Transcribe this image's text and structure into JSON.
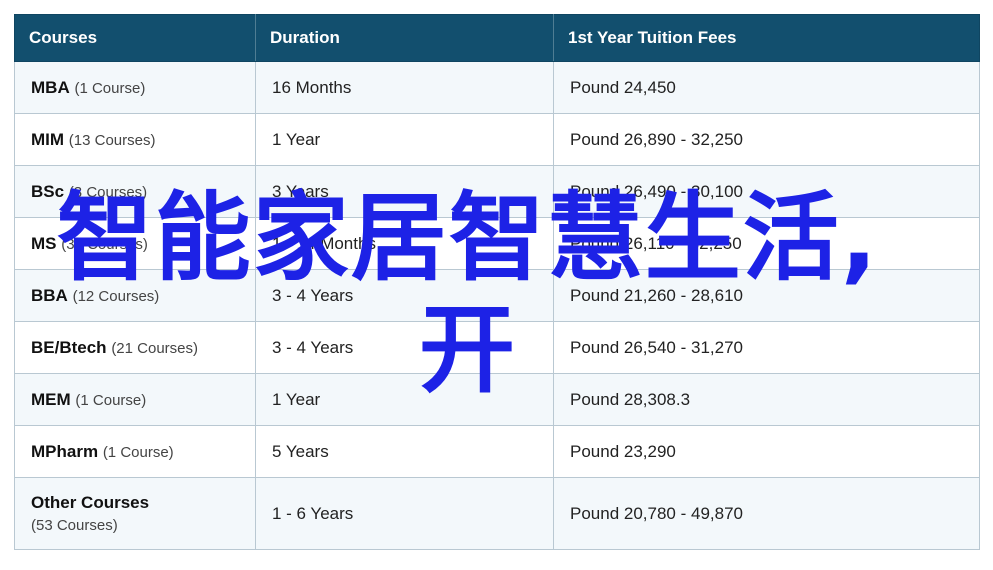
{
  "table": {
    "headers": [
      "Courses",
      "Duration",
      "1st Year Tuition Fees"
    ],
    "rows": [
      {
        "name": "MBA",
        "count": "(1 Course)",
        "duration": "16 Months",
        "fee": "Pound 24,450"
      },
      {
        "name": "MIM",
        "count": "(13 Courses)",
        "duration": "1 Year",
        "fee": "Pound 26,890 - 32,250"
      },
      {
        "name": "BSc",
        "count": "(3 Courses)",
        "duration": "3 Years",
        "fee": "Pound 26,490 - 30,100"
      },
      {
        "name": "MS",
        "count": "(39 Courses)",
        "duration": "1 - 14 Months",
        "fee": "Pound 26,110 - 32,250"
      },
      {
        "name": "BBA",
        "count": "(12 Courses)",
        "duration": "3 - 4 Years",
        "fee": "Pound 21,260 - 28,610"
      },
      {
        "name": "BE/Btech",
        "count": "(21 Courses)",
        "duration": "3 - 4 Years",
        "fee": "Pound 26,540 - 31,270"
      },
      {
        "name": "MEM",
        "count": "(1 Course)",
        "duration": "1 Year",
        "fee": "Pound 28,308.3"
      },
      {
        "name": "MPharm",
        "count": "(1 Course)",
        "duration": "5 Years",
        "fee": "Pound 23,290"
      },
      {
        "name": "Other Courses",
        "count": "(53 Courses)",
        "duration": "1 - 6 Years",
        "fee": "Pound 20,780 - 49,870"
      }
    ]
  },
  "overlay": {
    "line1": "智能家居智慧生活,",
    "line2": "开",
    "color": "#1d22e6"
  }
}
